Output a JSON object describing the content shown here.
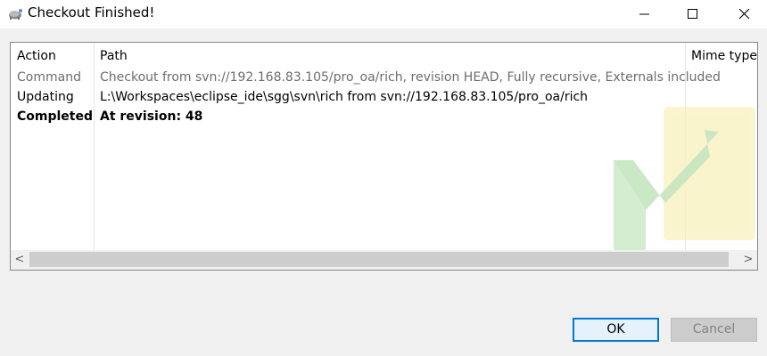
{
  "window": {
    "title": "Checkout Finished!",
    "app_icon": "tortoise-icon",
    "controls": [
      "minimize-icon",
      "maximize-icon",
      "close-icon"
    ]
  },
  "table": {
    "columns": [
      "Action",
      "Path",
      "Mime type"
    ],
    "rows": [
      {
        "action": "Command",
        "path": "Checkout from svn://192.168.83.105/pro_oa/rich, revision HEAD, Fully recursive, Externals included",
        "style": "gray"
      },
      {
        "action": "Updating",
        "path": "L:\\Workspaces\\eclipse_ide\\sgg\\svn\\rich from svn://192.168.83.105/pro_oa/rich",
        "style": "normal"
      },
      {
        "action": "Completed",
        "path": "At revision: 48",
        "style": "bold"
      }
    ],
    "watermark_icon": "checkmark-arrow-icon"
  },
  "scrollbar": {
    "left_arrow": "<",
    "right_arrow": ">"
  },
  "buttons": {
    "ok": "OK",
    "cancel": "Cancel"
  },
  "colors": {
    "focus_border": "#0078d7",
    "watermark_green": "#c5e5c0",
    "watermark_yellow": "#f7f0b4"
  }
}
